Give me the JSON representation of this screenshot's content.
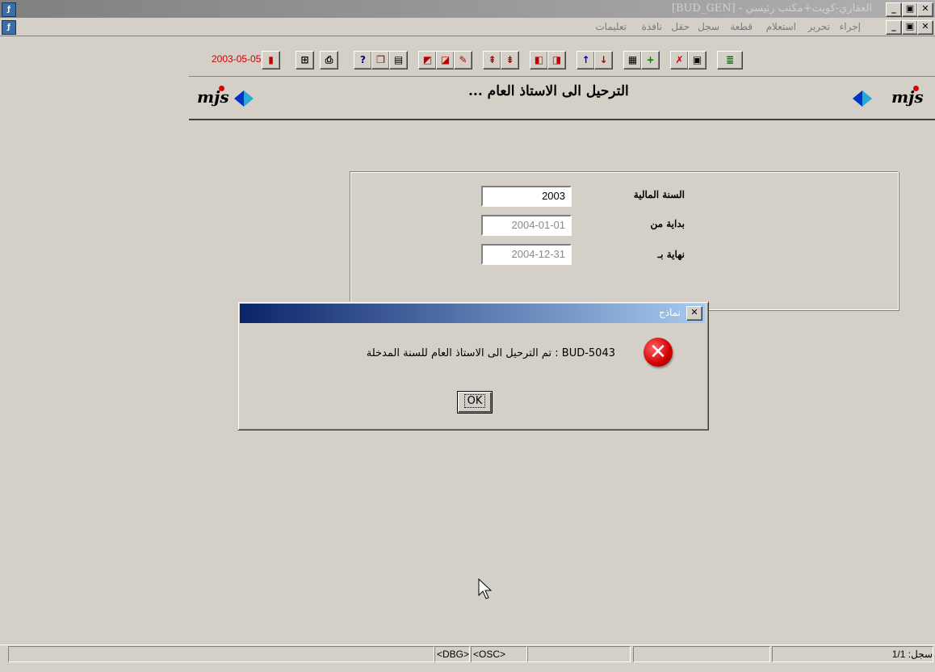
{
  "window": {
    "title": "العقاري-كويت+مكتب رئيسي - [BUD_GEN]",
    "icon": "oracle-forms-icon"
  },
  "menu": {
    "items": [
      "إجراء",
      "تحرير",
      "استعلام",
      "قطعة",
      "سجل",
      "حقل",
      "نافذة",
      "تعليمات"
    ]
  },
  "toolbar": {
    "date": "2003-05-05",
    "buttons": [
      "exit",
      "print-setup",
      "print",
      "help",
      "copy",
      "paste",
      "enter-query",
      "execute-query",
      "edit",
      "prev-block",
      "next-block",
      "prev-record",
      "next-record",
      "up",
      "down",
      "insert",
      "new-record",
      "delete-record",
      "save",
      "list-values"
    ]
  },
  "banner": {
    "title": "الترحيل الى الاستاذ العام ...",
    "logo_text": "mjs"
  },
  "form": {
    "fiscal_year_label": "السنة المالية",
    "fiscal_year_value": "2003",
    "start_label": "بداية من",
    "start_value": "2004-01-01",
    "end_label": "نهاية بـ",
    "end_value": "2004-12-31"
  },
  "dialog": {
    "title": "نماذج",
    "message": "BUD-5043 : تم الترحيل الى الاستاذ العام للسنة المدخلة",
    "ok_label": "OK",
    "icon": "error-icon"
  },
  "statusbar": {
    "record": "سجل: 1/1",
    "dbg": "<DBG>",
    "osc": "<OSC>"
  }
}
